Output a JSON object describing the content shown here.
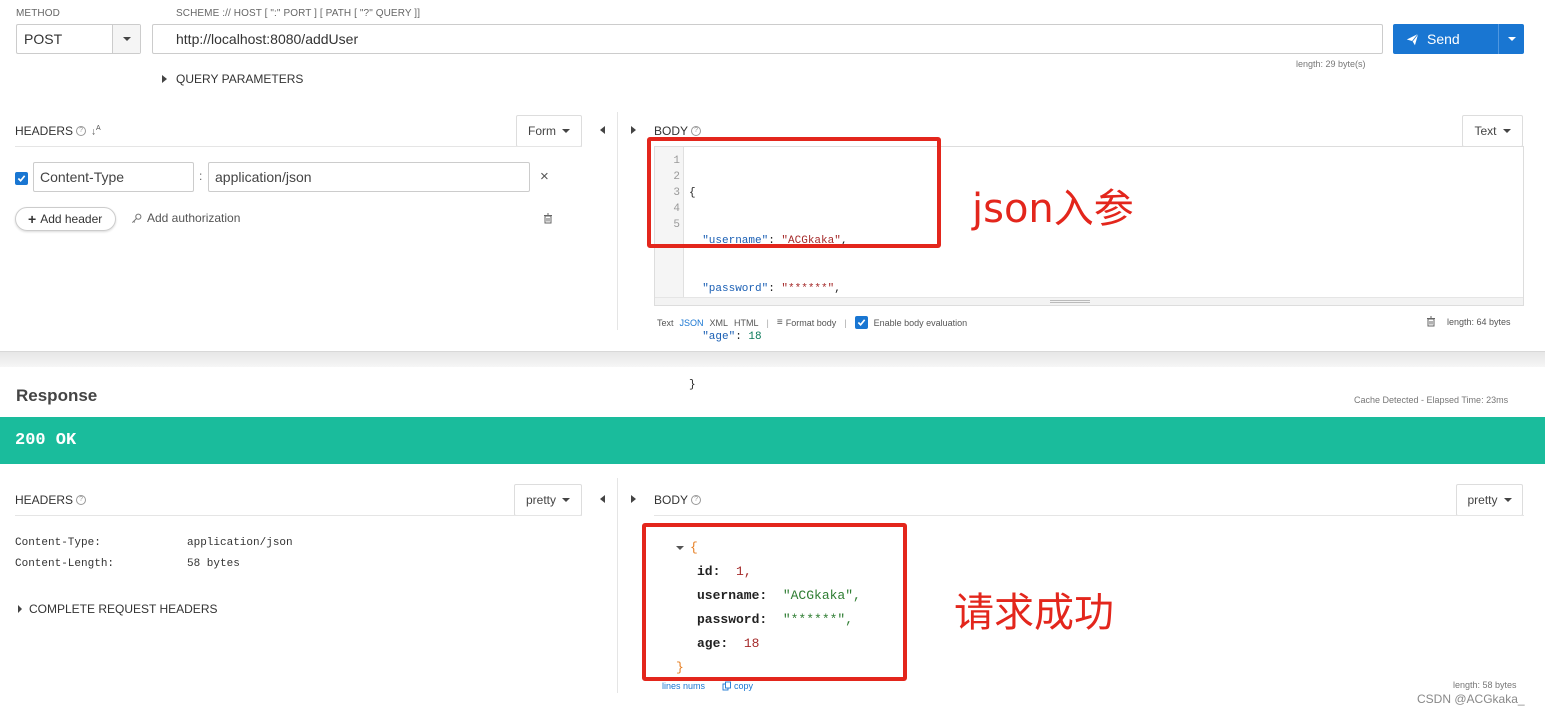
{
  "request": {
    "method_label": "METHOD",
    "url_label": "SCHEME :// HOST [ \":\" PORT ] [ PATH [ \"?\" QUERY ]]",
    "method": "POST",
    "url": "http://localhost:8080/addUser",
    "send_label": "Send",
    "length_info": "length: 29 byte(s)",
    "query_params_label": "QUERY PARAMETERS"
  },
  "headers_panel": {
    "title": "HEADERS",
    "mode": "Form",
    "rows": [
      {
        "name": "Content-Type",
        "value": "application/json",
        "checked": true
      }
    ],
    "add_header_label": "Add header",
    "add_auth_label": "Add authorization"
  },
  "body_panel": {
    "title": "BODY",
    "mode": "Text",
    "line_numbers": [
      "1",
      "2",
      "3",
      "4",
      "5"
    ],
    "code": {
      "open": "{",
      "k_username": "\"username\"",
      "v_username": "\"ACGkaka\"",
      "k_password": "\"password\"",
      "v_password": "\"******\"",
      "k_age": "\"age\"",
      "v_age": "18",
      "close": "}"
    },
    "footer": {
      "text": "Text",
      "json": "JSON",
      "xml": "XML",
      "html": "HTML",
      "format": "Format body",
      "enable_eval": "Enable body evaluation",
      "length": "length: 64 bytes"
    },
    "annotation": "json入参"
  },
  "response": {
    "title": "Response",
    "meta": "Cache Detected - Elapsed Time: 23ms",
    "status": "200 OK",
    "status_color": "#1abc9c",
    "headers_title": "HEADERS",
    "headers_mode": "pretty",
    "headers": [
      {
        "name": "Content-Type:",
        "value": "application/json"
      },
      {
        "name": "Content-Length:",
        "value": "58 bytes"
      }
    ],
    "complete_headers_label": "COMPLETE REQUEST HEADERS",
    "body_title": "BODY",
    "body_mode": "pretty",
    "json": {
      "open": "{",
      "id_key": "id:",
      "id_val": "1,",
      "username_key": "username:",
      "username_val": "\"ACGkaka\",",
      "password_key": "password:",
      "password_val": "\"******\",",
      "age_key": "age:",
      "age_val": "18",
      "close": "}"
    },
    "lines_nums": "lines nums",
    "copy": "copy",
    "length": "length: 58 bytes",
    "annotation": "请求成功"
  },
  "watermark": "CSDN @ACGkaka_",
  "colors": {
    "send_blue": "#1976d2",
    "annotation_red": "#e3261c",
    "json_key_blue": "#1a5fb4",
    "json_string_brown": "#a52a2a"
  }
}
